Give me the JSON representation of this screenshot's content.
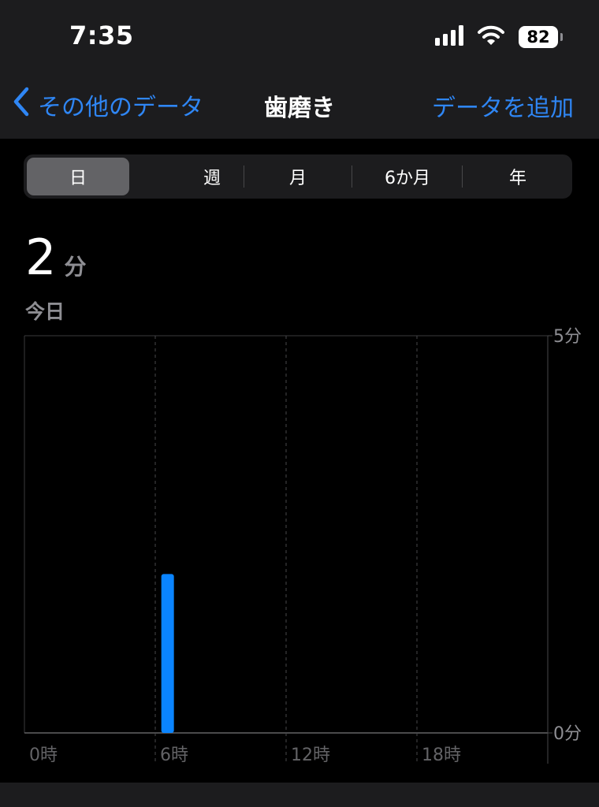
{
  "status_bar": {
    "time": "7:35",
    "battery": "82"
  },
  "nav": {
    "back_label": "その他のデータ",
    "title": "歯磨き",
    "add_label": "データを追加"
  },
  "segments": [
    {
      "label": "日",
      "selected": true
    },
    {
      "label": "週",
      "selected": false
    },
    {
      "label": "月",
      "selected": false
    },
    {
      "label": "6か月",
      "selected": false
    },
    {
      "label": "年",
      "selected": false
    }
  ],
  "summary": {
    "value": "2",
    "unit": "分",
    "date_label": "今日"
  },
  "colors": {
    "accent": "#2f86f4",
    "bar": "#0a84ff",
    "nav_bg": "#1c1c1e"
  },
  "chart_data": {
    "type": "bar",
    "x_unit": "hour",
    "x_ticks": [
      "0時",
      "6時",
      "12時",
      "18時"
    ],
    "y_ticks": [
      "5分",
      "0分"
    ],
    "ylim": [
      0,
      5
    ],
    "xlim": [
      0,
      24
    ],
    "bars": [
      {
        "hour": 7,
        "value": 2
      }
    ],
    "grid": true
  }
}
